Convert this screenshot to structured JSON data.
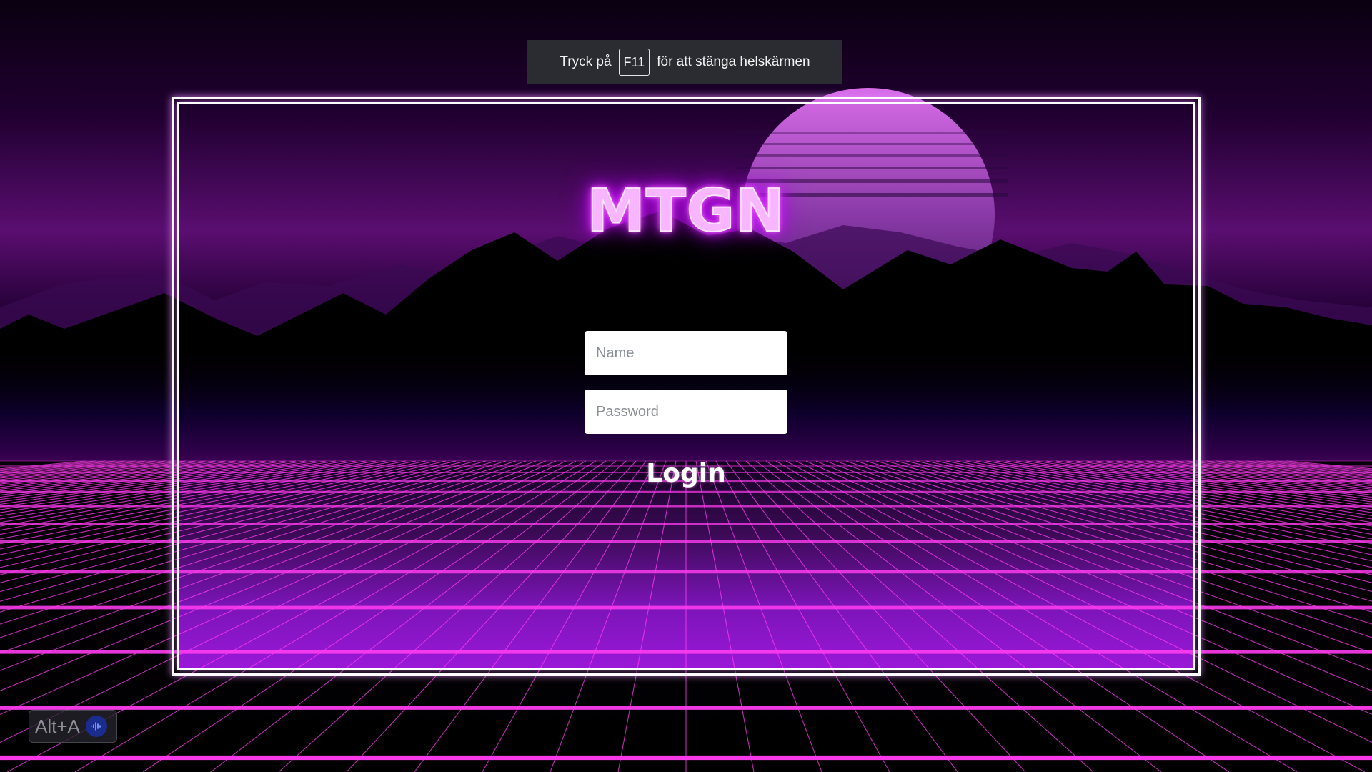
{
  "banner": {
    "text_before": "Tryck på",
    "key": "F11",
    "text_after": "för att stänga helskärmen"
  },
  "logo": {
    "text": "MTGN"
  },
  "form": {
    "name_placeholder": "Name",
    "name_value": "",
    "password_placeholder": "Password",
    "password_value": "",
    "login_label": "Login"
  },
  "shortcut_badge": {
    "label": "Alt+A",
    "icon": "audio-wave-icon"
  },
  "colors": {
    "neon_pink": "#e040fb",
    "grid_line": "#ff3cf0",
    "frame": "#ffffff",
    "sun_top": "#c35ad8",
    "sky_dark": "#0a0010"
  },
  "icons": {
    "sun": "sun-icon",
    "mountains": "mountains-icon",
    "grid": "grid-floor-icon"
  }
}
